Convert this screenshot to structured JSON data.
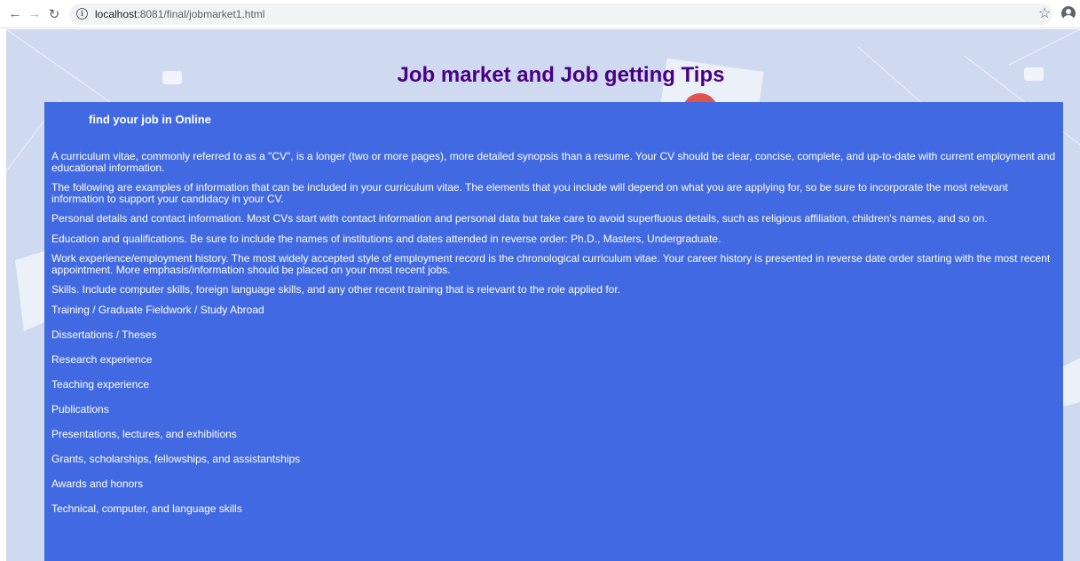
{
  "browser": {
    "url_host": "localhost",
    "url_path": ":8081/final/jobmarket1.html",
    "back_icon": "back-arrow-icon",
    "forward_icon": "forward-arrow-icon",
    "reload_icon": "reload-icon",
    "bookmark_icon": "star-icon",
    "profile_icon": "account-circle-icon"
  },
  "page": {
    "title": "Job market and Job getting Tips",
    "subtitle": "find your job in Online",
    "paragraphs": [
      "A curriculum vitae, commonly referred to as a \"CV\", is a longer (two or more pages), more detailed synopsis than a resume. Your CV should be clear, concise, complete, and up-to-date with current employment and educational information.",
      "The following are examples of information that can be included in your curriculum vitae. The elements that you include will depend on what you are applying for, so be sure to incorporate the most relevant information to support your candidacy in your CV.",
      "Personal details and contact information. Most CVs start with contact information and personal data but take care to avoid superfluous details, such as religious affiliation, children's names, and so on.",
      "Education and qualifications. Be sure to include the names of institutions and dates attended in reverse order: Ph.D., Masters, Undergraduate.",
      "Work experience/employment history. The most widely accepted style of employment record is the chronological curriculum vitae. Your career history is presented in reverse date order starting with the most recent appointment. More emphasis/information should be placed on your most recent jobs.",
      "Skills. Include computer skills, foreign language skills, and any other recent training that is relevant to the role applied for."
    ],
    "items": [
      "Training / Graduate Fieldwork / Study Abroad",
      "Dissertations / Theses",
      "Research experience",
      "Teaching experience",
      "Publications",
      "Presentations, lectures, and exhibitions",
      "Grants, scholarships, fellowships, and assistantships",
      "Awards and honors",
      "Technical, computer, and language skills"
    ]
  },
  "colors": {
    "page_background": "#cfd9f0",
    "content_background": "#4169e1",
    "title_color": "#4b0082",
    "content_text": "#ffffff"
  }
}
